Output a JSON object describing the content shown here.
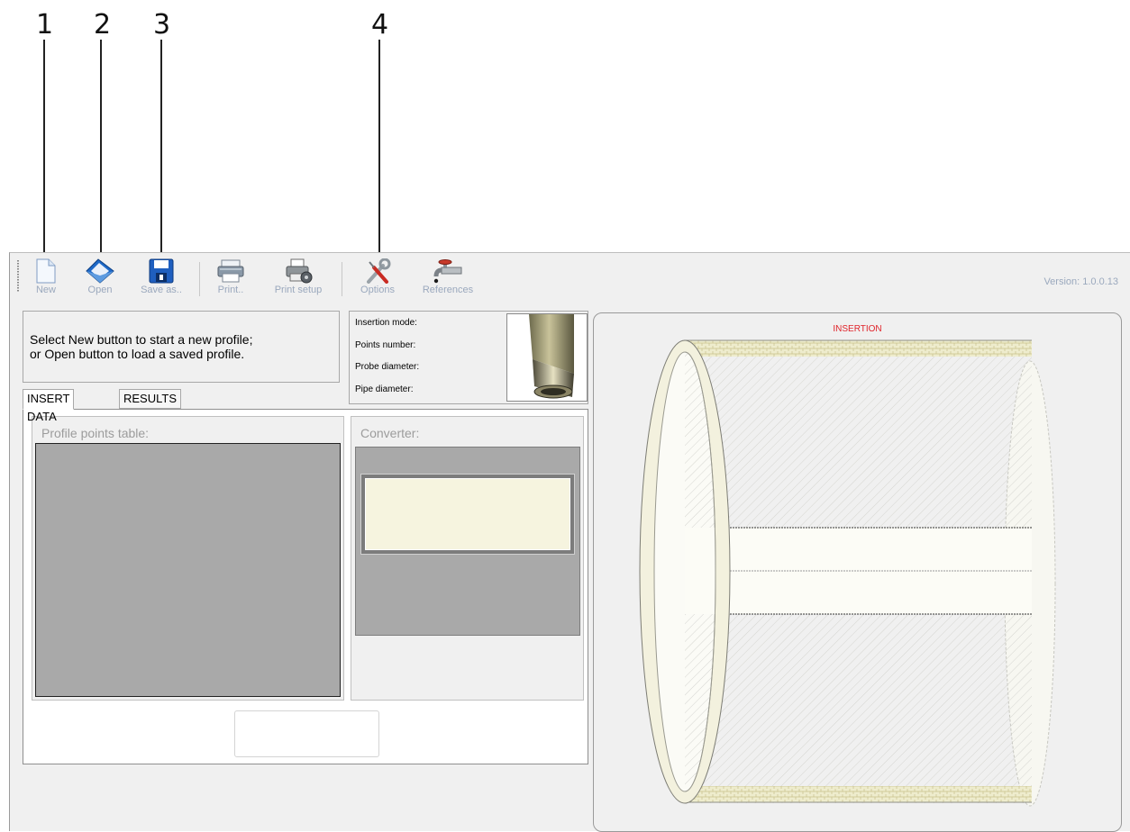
{
  "callouts": [
    "1",
    "2",
    "3",
    "4"
  ],
  "toolbar": {
    "new_label": "New",
    "open_label": "Open",
    "saveas_label": "Save as..",
    "print_label": "Print..",
    "printsetup_label": "Print setup",
    "options_label": "Options",
    "references_label": "References"
  },
  "version": "Version: 1.0.0.13",
  "message": {
    "line1": "Select New button to start a new profile;",
    "line2": "or Open button to load a saved profile."
  },
  "info": {
    "insertion_mode": "Insertion mode:",
    "points_number": "Points number:",
    "probe_diameter": "Probe diameter:",
    "pipe_diameter": "Pipe diameter:"
  },
  "tabs": [
    "INSERT DATA",
    "RESULTS"
  ],
  "profile_table_title": "Profile points table:",
  "converter_title": "Converter:",
  "diagram_title": "INSERTION",
  "colors": {
    "label_blue": "#9aa8bd",
    "insertion_red": "#e0242b",
    "screen": "#f6f4df",
    "gray_area": "#a9a9a9"
  }
}
